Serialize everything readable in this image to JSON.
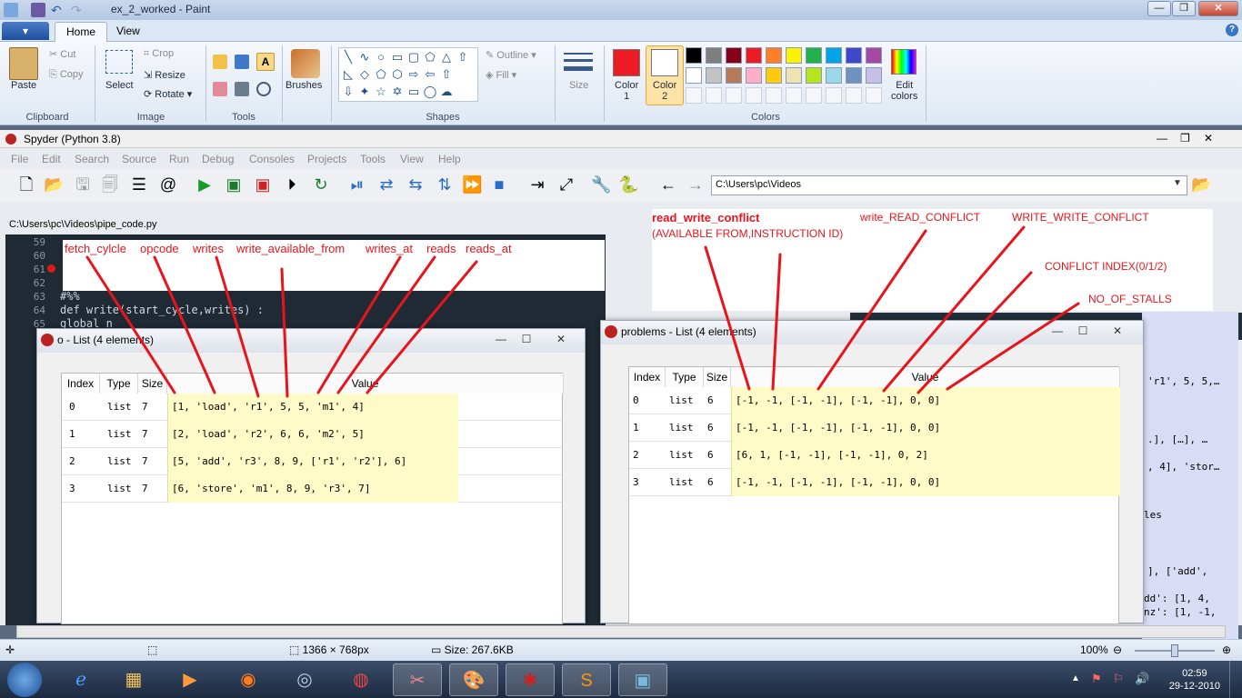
{
  "paint": {
    "title": "ex_2_worked - Paint",
    "tabs": {
      "file_icon": "▾",
      "home": "Home",
      "view": "View"
    },
    "clipboard": {
      "paste": "Paste",
      "cut": "Cut",
      "copy": "Copy",
      "label": "Clipboard"
    },
    "image": {
      "select": "Select",
      "crop": "Crop",
      "resize": "Resize",
      "rotate": "Rotate",
      "label": "Image"
    },
    "tools_label": "Tools",
    "brushes": "Brushes",
    "shapes": {
      "outline": "Outline",
      "fill": "Fill",
      "label": "Shapes"
    },
    "size": "Size",
    "color1": "Color\n1",
    "color2": "Color\n2",
    "colors_label": "Colors",
    "edit_colors": "Edit\ncolors",
    "palette_row1": [
      "#000000",
      "#7f7f7f",
      "#880015",
      "#ed1c24",
      "#ff7f27",
      "#fff200",
      "#22b14c",
      "#00a2e8",
      "#3f48cc",
      "#a349a4"
    ],
    "palette_row2": [
      "#ffffff",
      "#c3c3c3",
      "#b97a57",
      "#ffaec9",
      "#ffc90e",
      "#efe4b0",
      "#b5e61d",
      "#99d9ea",
      "#7092be",
      "#c8bfe7"
    ],
    "status": {
      "dimensions": "1366 × 768px",
      "size": "Size: 267.6KB",
      "zoom": "100%"
    }
  },
  "spyder": {
    "title": "Spyder (Python 3.8)",
    "menu": [
      "File",
      "Edit",
      "Search",
      "Source",
      "Run",
      "Debug",
      "Consoles",
      "Projects",
      "Tools",
      "View",
      "Help"
    ],
    "path": "C:\\Users\\pc\\Videos",
    "file_path": "C:\\Users\\pc\\Videos\\pipe_code.py",
    "editor_lines": [
      {
        "num": "59",
        "code": ""
      },
      {
        "num": "60",
        "code": ""
      },
      {
        "num": "61",
        "code": ""
      },
      {
        "num": "62",
        "code": ""
      },
      {
        "num": "63",
        "code": "#%%"
      },
      {
        "num": "64",
        "code": "def write(start_cycle,writes) :"
      },
      {
        "num": "65",
        "code": "    global n"
      }
    ],
    "right_panel_snippets": [
      "'r1', 5, 5,…",
      ".], […], …",
      ", 4], 'stor…",
      "les",
      "], ['add',",
      "dd': [1, 4,",
      "nz': [1, -1,"
    ]
  },
  "annotations": {
    "top": [
      "fetch_cylcle",
      "opcode",
      "writes",
      "write_available_from",
      "writes_at",
      "reads",
      "reads_at"
    ],
    "right": {
      "rwc": "read_write_conflict",
      "rwc_sub": "(AVAILABLE FROM,INSTRUCTION ID)",
      "wrc": "write_READ_CONFLICT",
      "wwc": "WRITE_WRITE_CONFLICT",
      "ci": "CONFLICT INDEX(0/1/2)",
      "ns": "NO_OF_STALLS"
    }
  },
  "list_o": {
    "title": "o - List (4 elements)",
    "headers": [
      "Index",
      "Type",
      "Size",
      "Value"
    ],
    "rows": [
      {
        "index": "0",
        "type": "list",
        "size": "7",
        "value": "[1, 'load', 'r1', 5, 5, 'm1', 4]"
      },
      {
        "index": "1",
        "type": "list",
        "size": "7",
        "value": "[2, 'load', 'r2', 6, 6, 'm2', 5]"
      },
      {
        "index": "2",
        "type": "list",
        "size": "7",
        "value": "[5, 'add', 'r3', 8, 9, ['r1', 'r2'], 6]"
      },
      {
        "index": "3",
        "type": "list",
        "size": "7",
        "value": "[6, 'store', 'm1', 8, 9, 'r3', 7]"
      }
    ]
  },
  "list_problems": {
    "title": "problems - List (4 elements)",
    "headers": [
      "Index",
      "Type",
      "Size",
      "Value"
    ],
    "rows": [
      {
        "index": "0",
        "type": "list",
        "size": "6",
        "value": "[-1, -1, [-1, -1], [-1, -1], 0, 0]"
      },
      {
        "index": "1",
        "type": "list",
        "size": "6",
        "value": "[-1, -1, [-1, -1], [-1, -1], 0, 0]"
      },
      {
        "index": "2",
        "type": "list",
        "size": "6",
        "value": "[6, 1, [-1, -1], [-1, -1], 0, 2]"
      },
      {
        "index": "3",
        "type": "list",
        "size": "6",
        "value": "[-1, -1, [-1, -1], [-1, -1], 0, 0]"
      }
    ]
  },
  "taskbar": {
    "time": "02:59",
    "date": "29-12-2010"
  }
}
